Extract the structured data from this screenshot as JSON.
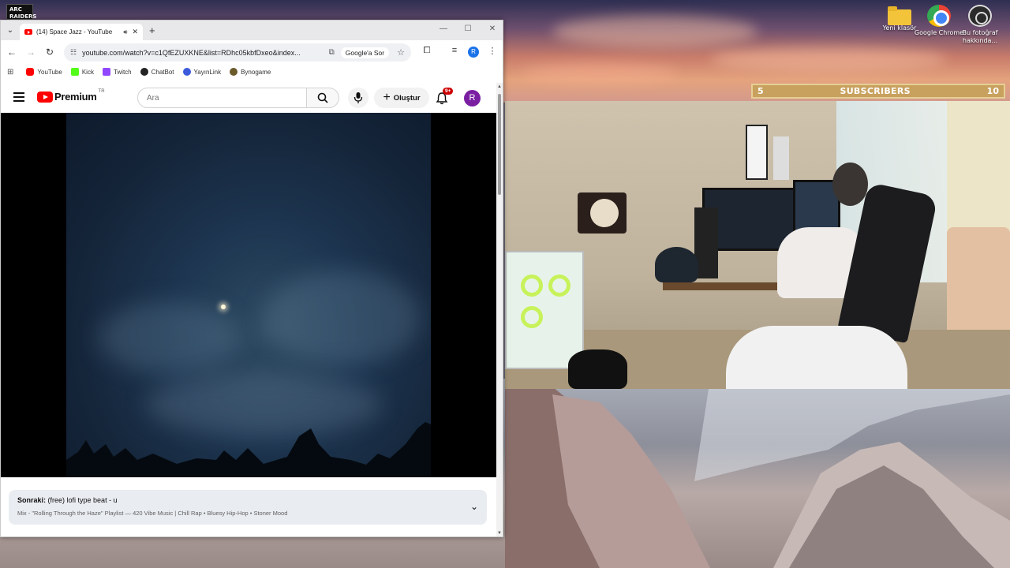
{
  "desktop": {
    "corner_logo": "ARC RAIDERS",
    "icons": [
      {
        "label": "Yeni klasör",
        "icon": "folder-icon"
      },
      {
        "label": "Google Chrome",
        "icon": "chrome-icon"
      },
      {
        "label": "Bu fotoğraf hakkında...",
        "icon": "photo-info-icon"
      }
    ]
  },
  "stream_overlay": {
    "subscribers": {
      "current": "5",
      "label": "SUBSCRIBERS",
      "goal": "10",
      "accent": "#c8a15e"
    }
  },
  "browser": {
    "tab": {
      "title": "(14) Space Jazz - YouTube"
    },
    "address": {
      "url": "youtube.com/watch?v=c1QfEZUXKNE&list=RDhc05kbfDxeo&index...",
      "google_chip": "Google'a Sor"
    },
    "bookmarks": [
      {
        "label": "YouTube",
        "color": "#ff0000"
      },
      {
        "label": "Kick",
        "color": "#53fc18"
      },
      {
        "label": "Twitch",
        "color": "#9146ff"
      },
      {
        "label": "ChatBot",
        "color": "#222222"
      },
      {
        "label": "YayınLink",
        "color": "#3b5bdb"
      },
      {
        "label": "Bynogame",
        "color": "#6b5a2a"
      }
    ],
    "profile_initial": "R"
  },
  "youtube": {
    "logo_text": "Premium",
    "country": "TR",
    "search_placeholder": "Ara",
    "create_label": "Oluştur",
    "notifications_badge": "9+",
    "avatar_initial": "R",
    "up_next": {
      "prefix": "Sonraki:",
      "title": "(free) lofi type beat - u",
      "playlist": "Mix - \"Rolling Through the Haze\" Playlist — 420 Vibe Music | Chill Rap • Bluesy Hip-Hop • Stoner Mood"
    }
  }
}
